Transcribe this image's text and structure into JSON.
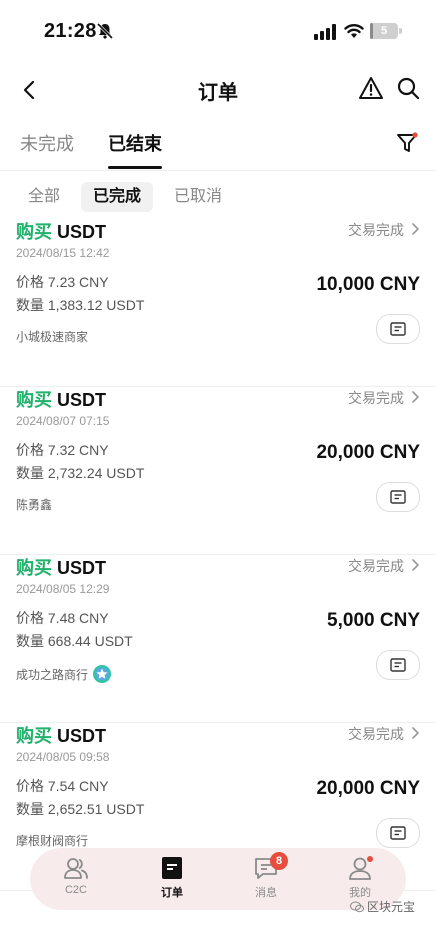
{
  "status_bar": {
    "time": "21:28",
    "battery": "5",
    "battery_level": 0.05
  },
  "nav": {
    "title": "订单"
  },
  "tabs": [
    {
      "label": "未完成",
      "active": false
    },
    {
      "label": "已结束",
      "active": true
    }
  ],
  "subtabs": [
    {
      "label": "全部",
      "active": false
    },
    {
      "label": "已完成",
      "active": true
    },
    {
      "label": "已取消",
      "active": false
    }
  ],
  "labels": {
    "price": "价格",
    "qty": "数量"
  },
  "orders": [
    {
      "side": "购买",
      "asset": "USDT",
      "status": "交易完成",
      "date": "2024/08/15 12:42",
      "price": "7.23 CNY",
      "qty": "1,383.12 USDT",
      "amount": "10,000 CNY",
      "merchant": "小城极速商家"
    },
    {
      "side": "购买",
      "asset": "USDT",
      "status": "交易完成",
      "date": "2024/08/07 07:15",
      "price": "7.32 CNY",
      "qty": "2,732.24 USDT",
      "amount": "20,000 CNY",
      "merchant": "陈勇鑫"
    },
    {
      "side": "购买",
      "asset": "USDT",
      "status": "交易完成",
      "date": "2024/08/05 12:29",
      "price": "7.48 CNY",
      "qty": "668.44 USDT",
      "amount": "5,000 CNY",
      "merchant": "成功之路商行"
    },
    {
      "side": "购买",
      "asset": "USDT",
      "status": "交易完成",
      "date": "2024/08/05 09:58",
      "price": "7.54 CNY",
      "qty": "2,652.51 USDT",
      "amount": "20,000 CNY",
      "merchant": "摩根财阀商行"
    }
  ],
  "bottom_nav": [
    {
      "label": "C2C",
      "icon": "people-icon",
      "active": false
    },
    {
      "label": "订单",
      "icon": "order-icon",
      "active": true
    },
    {
      "label": "消息",
      "icon": "message-icon",
      "active": false,
      "badge": "8"
    },
    {
      "label": "我的",
      "icon": "user-icon",
      "active": false
    }
  ],
  "watermark": "区块元宝",
  "colors": {
    "buy": "#20b26c",
    "badge": "#e64d3d",
    "bottom_nav_bg": "#f7eceb"
  }
}
